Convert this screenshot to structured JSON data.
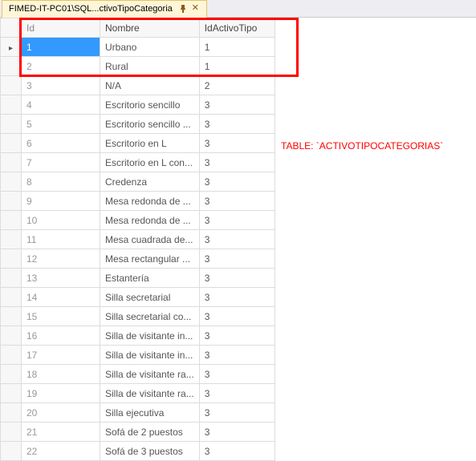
{
  "tab": {
    "title": "FIMED-IT-PC01\\SQL...ctivoTipoCategoria"
  },
  "annotation": {
    "label": "TABLE: `ACTIVOTIPOCATEGORIAS`"
  },
  "columns": [
    "Id",
    "Nombre",
    "IdActivoTipo"
  ],
  "rows": [
    {
      "id": "1",
      "nombre": "Urbano",
      "tipo": "1"
    },
    {
      "id": "2",
      "nombre": "Rural",
      "tipo": "1"
    },
    {
      "id": "3",
      "nombre": "N/A",
      "tipo": "2"
    },
    {
      "id": "4",
      "nombre": "Escritorio sencillo",
      "tipo": "3"
    },
    {
      "id": "5",
      "nombre": "Escritorio sencillo ...",
      "tipo": "3"
    },
    {
      "id": "6",
      "nombre": "Escritorio en L",
      "tipo": "3"
    },
    {
      "id": "7",
      "nombre": "Escritorio en L con...",
      "tipo": "3"
    },
    {
      "id": "8",
      "nombre": "Credenza",
      "tipo": "3"
    },
    {
      "id": "9",
      "nombre": "Mesa redonda de ...",
      "tipo": "3"
    },
    {
      "id": "10",
      "nombre": "Mesa redonda de ...",
      "tipo": "3"
    },
    {
      "id": "11",
      "nombre": "Mesa cuadrada de...",
      "tipo": "3"
    },
    {
      "id": "12",
      "nombre": "Mesa rectangular ...",
      "tipo": "3"
    },
    {
      "id": "13",
      "nombre": "Estantería",
      "tipo": "3"
    },
    {
      "id": "14",
      "nombre": "Silla secretarial",
      "tipo": "3"
    },
    {
      "id": "15",
      "nombre": "Silla secretarial co...",
      "tipo": "3"
    },
    {
      "id": "16",
      "nombre": "Silla de visitante in...",
      "tipo": "3"
    },
    {
      "id": "17",
      "nombre": "Silla de visitante in...",
      "tipo": "3"
    },
    {
      "id": "18",
      "nombre": "Silla de visitante ra...",
      "tipo": "3"
    },
    {
      "id": "19",
      "nombre": "Silla de visitante ra...",
      "tipo": "3"
    },
    {
      "id": "20",
      "nombre": "Silla ejecutiva",
      "tipo": "3"
    },
    {
      "id": "21",
      "nombre": "Sofá de 2 puestos",
      "tipo": "3"
    },
    {
      "id": "22",
      "nombre": "Sofá de 3 puestos",
      "tipo": "3"
    }
  ]
}
